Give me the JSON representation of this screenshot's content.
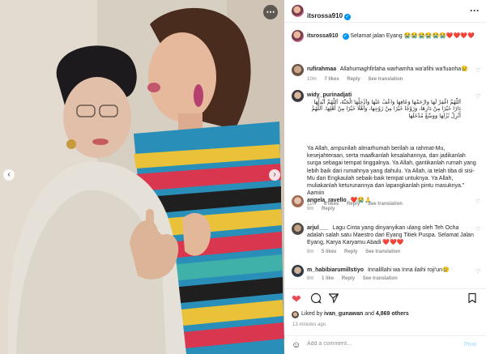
{
  "photo": {
    "more_icon": "more-horizontal-icon",
    "prev_icon": "chevron-left-icon",
    "next_icon": "chevron-right-icon"
  },
  "header": {
    "username": "itsrossa910",
    "verified_icon": "verified-badge-icon",
    "more_label": "···"
  },
  "caption": {
    "username": "itsrossa910",
    "text": "Selamat jalan Eyang 😭😭😭😭😭😭❤️❤️❤️❤️",
    "hearts": "❤️❤️❤️"
  },
  "comments": [
    {
      "username": "rufirahmaa",
      "text": "Allahumaghfirlaha warhamha wa'afihi wa'fuanha😢",
      "age": "10m",
      "likes": "7 likes",
      "reply": "Reply",
      "translation": "See translation"
    },
    {
      "username": "widy_purinadjati",
      "arabic": "اَللّٰهُمَّ اغْفِرْ لَهَا وَارْحَمْهَا وَعَافِهَا وَاعْفُ عَنْهَا وَاَدْخِلْهَا الْجَنَّةَ، اَللّٰهُمَّ أَبْدِلْهَا دَارًا خَيْرًا مِنْ دَارِهَا، وَزَوْجًا خَيْرًا مِنْ زَوْجِهَا، وَأَهْلًا خَيْرًا مِنْ أَهْلِهَا. اَللّٰهُمَّ أَنْزِلْ نُزُلَهَا وَوَسِّعْ مُدْخَلَهَا",
      "text": "Ya Allah, ampunilah almarhumah berilah ia rahmat-Mu, kesejahteraan, serta maafkanlah kesalahannya, dan jadikanlah surga sebagai tempat tinggalnya. Ya Allah, gantikanlah rumah yang lebih baik dari rumahnya yang dahulu. Ya Allah, ia telah tiba di sisi-Mu dan Engkaulah sebaik-baik tempat untuknya. Ya Allah, muliakanlah keturunannya dan lapangkanlah pintu masuknya.\" Aamiin",
      "age": "11m",
      "likes": "6 likes",
      "reply": "Reply",
      "translation": "See translation"
    },
    {
      "username": "angela_ravello",
      "text": "❤️😭🙏",
      "age": "9m",
      "reply": "Reply"
    },
    {
      "username": "arjul___",
      "text": "Lagu Cinta yang dinyanyikan ulang oleh Teh Ocha adalah salah satu Maestro dari Eyang Titiek Puspa. Selamat Jalan Eyang, Karya Karyamu Abadi ❤️❤️❤️",
      "age": "8m",
      "likes": "5 likes",
      "reply": "Reply",
      "translation": "See translation"
    },
    {
      "username": "m_habibiarumillstiyo",
      "text": "Innalillahi wa Inna ilaihi roji'un😢",
      "age": "8m",
      "likes": "1 like",
      "reply": "Reply",
      "translation": "See translation"
    }
  ],
  "actions": {
    "like_icon": "heart-filled-icon",
    "comment_icon": "comment-icon",
    "share_icon": "share-icon",
    "save_icon": "bookmark-icon"
  },
  "likes": {
    "prefix": "Liked by",
    "user": "ivan_gunawan",
    "and": "and",
    "count": "4,869 others"
  },
  "timestamp": "13 minutes ago",
  "add_comment": {
    "emoji_icon": "emoji-icon",
    "placeholder": "Add a comment…",
    "post_label": "Post"
  }
}
